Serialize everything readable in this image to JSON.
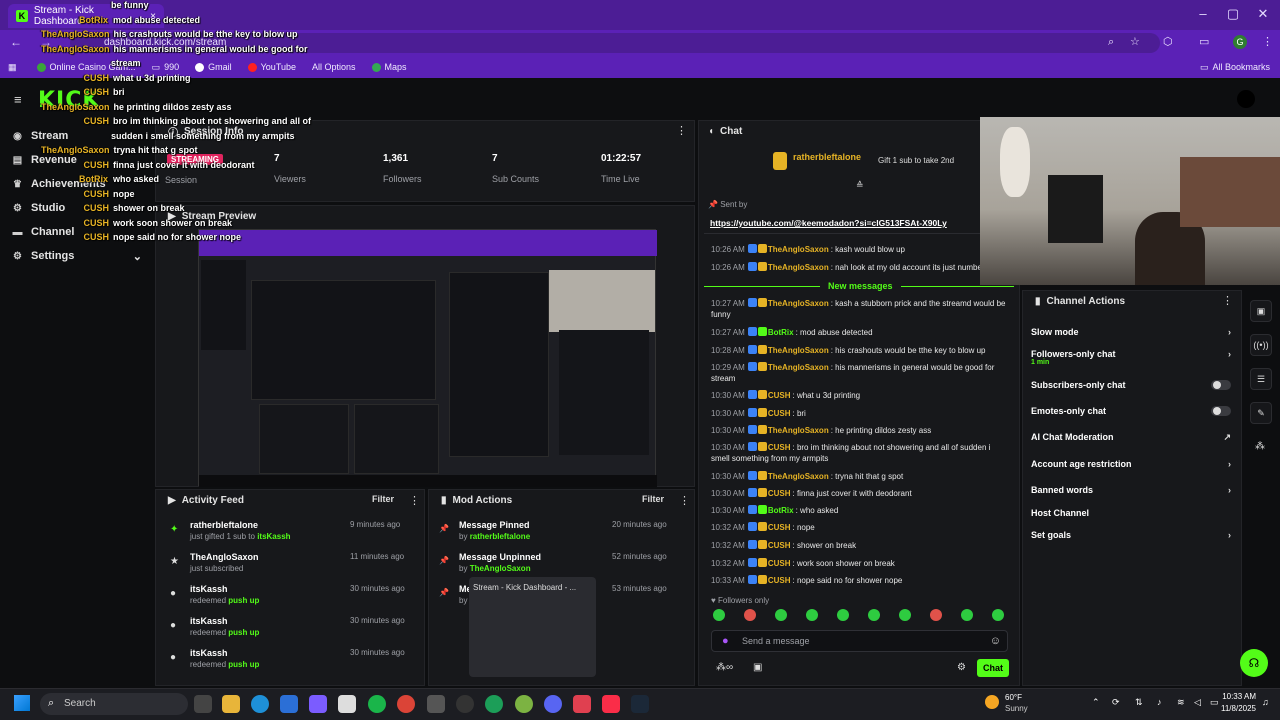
{
  "browser": {
    "tab_title": "Stream - Kick Dashboard",
    "url": "dashboard.kick.com/stream",
    "bookmarks": [
      "Online Casino Gam...",
      "990",
      "Gmail",
      "YouTube",
      "All Options",
      "Maps"
    ],
    "all_bookmarks": "All Bookmarks",
    "profile_letter": "G"
  },
  "app": {
    "logo": "KICK",
    "nav": [
      "Stream",
      "Revenue",
      "Achievements",
      "Studio",
      "Channel",
      "Settings"
    ],
    "session_info_title": "Session Info",
    "session": {
      "badge": "STREAMING",
      "label": "Session"
    },
    "stats": [
      {
        "value": "7",
        "label": "Viewers"
      },
      {
        "value": "1,361",
        "label": "Followers"
      },
      {
        "value": "7",
        "label": "Sub Counts"
      },
      {
        "value": "01:22:57",
        "label": "Time Live"
      }
    ],
    "stream_preview_title": "Stream Preview",
    "activity_feed": {
      "title": "Activity Feed",
      "filter": "Filter",
      "items": [
        {
          "name": "ratherbleftalone",
          "sub": "just gifted",
          "sub2": "1 sub to",
          "target": "itsKassh",
          "time": "9 minutes ago"
        },
        {
          "name": "TheAngloSaxon",
          "sub": "just subscribed",
          "sub2": "",
          "target": "",
          "time": "11 minutes ago"
        },
        {
          "name": "itsKassh",
          "sub": "redeemed",
          "sub2": "",
          "target": "push up",
          "time": "30 minutes ago"
        },
        {
          "name": "itsKassh",
          "sub": "redeemed",
          "sub2": "",
          "target": "push up",
          "time": "30 minutes ago"
        },
        {
          "name": "itsKassh",
          "sub": "redeemed",
          "sub2": "",
          "target": "push up",
          "time": "30 minutes ago"
        }
      ]
    },
    "mod_actions": {
      "title": "Mod Actions",
      "filter": "Filter",
      "items": [
        {
          "name": "Message Pinned",
          "by": "by",
          "who": "ratherbleftalone",
          "time": "20 minutes ago"
        },
        {
          "name": "Message Unpinned",
          "by": "by",
          "who": "TheAngloSaxon",
          "time": "52 minutes ago"
        },
        {
          "name": "Me",
          "by": "by",
          "who": "",
          "time": "53 minutes ago"
        }
      ],
      "tooltip": "Stream - Kick Dashboard - ..."
    }
  },
  "chat": {
    "title": "Chat",
    "pinned_user": "ratherbleftalone",
    "pinned_text": "Gift 1 sub to take 2nd",
    "sent_by": "Sent by",
    "pinned_link": "https://youtube.com/@keemodadon?si=cIG513FSAt-X90Ly",
    "new_messages": "New messages",
    "messages": [
      {
        "time": "10:26 AM",
        "user": "TheAngloSaxon",
        "text": "kash would blow up",
        "color": "gold"
      },
      {
        "time": "10:26 AM",
        "user": "TheAngloSaxon",
        "text": "nah look at my old account its just numbe",
        "color": "gold"
      },
      {
        "time": "10:27 AM",
        "user": "TheAngloSaxon",
        "text": "kash a stubborn prick and the streamd would be funny",
        "color": "gold"
      },
      {
        "time": "10:27 AM",
        "user": "BotRix",
        "text": "mod abuse detected",
        "color": "grn"
      },
      {
        "time": "10:28 AM",
        "user": "TheAngloSaxon",
        "text": "his crashouts would be tthe key to blow up",
        "color": "gold"
      },
      {
        "time": "10:29 AM",
        "user": "TheAngloSaxon",
        "text": "his mannerisms in general would be good for stream",
        "color": "gold"
      },
      {
        "time": "10:30 AM",
        "user": "CUSH",
        "text": "what u 3d printing",
        "color": "gold"
      },
      {
        "time": "10:30 AM",
        "user": "CUSH",
        "text": "bri",
        "color": "gold"
      },
      {
        "time": "10:30 AM",
        "user": "TheAngloSaxon",
        "text": "he printing dildos zesty ass",
        "color": "gold"
      },
      {
        "time": "10:30 AM",
        "user": "CUSH",
        "text": "bro im thinking about not showering and all of sudden i smell something from my armpits",
        "color": "gold"
      },
      {
        "time": "10:30 AM",
        "user": "TheAngloSaxon",
        "text": "tryna hit that g spot",
        "color": "gold"
      },
      {
        "time": "10:30 AM",
        "user": "CUSH",
        "text": "finna just cover it with deodorant",
        "color": "gold"
      },
      {
        "time": "10:30 AM",
        "user": "BotRix",
        "text": "who asked",
        "color": "grn"
      },
      {
        "time": "10:32 AM",
        "user": "CUSH",
        "text": "nope",
        "color": "gold"
      },
      {
        "time": "10:32 AM",
        "user": "CUSH",
        "text": "shower on break",
        "color": "gold"
      },
      {
        "time": "10:32 AM",
        "user": "CUSH",
        "text": "work soon shower on break",
        "color": "gold"
      },
      {
        "time": "10:33 AM",
        "user": "CUSH",
        "text": "nope said no for shower nope",
        "color": "gold"
      }
    ],
    "followers_only": "Followers only",
    "input_placeholder": "Send a message",
    "send_label": "Chat"
  },
  "channel_actions": {
    "title": "Channel Actions",
    "items": [
      {
        "label": "Slow mode",
        "kind": "chevron"
      },
      {
        "label": "Followers-only chat",
        "sub": "1 min",
        "kind": "chevron"
      },
      {
        "label": "Subscribers-only chat",
        "kind": "toggle"
      },
      {
        "label": "Emotes-only chat",
        "kind": "toggle"
      },
      {
        "label": "AI Chat Moderation",
        "kind": "external"
      },
      {
        "label": "Account age restriction",
        "kind": "chevron"
      },
      {
        "label": "Banned words",
        "kind": "chevron"
      },
      {
        "label": "Host Channel",
        "kind": "none"
      },
      {
        "label": "Set goals",
        "kind": "chevron"
      }
    ]
  },
  "overlay_chat": [
    {
      "user": "",
      "text": "be funny"
    },
    {
      "user": "BotRix",
      "text": "mod abuse detected"
    },
    {
      "user": "TheAngloSaxon",
      "text": "his crashouts would be tthe key to blow up"
    },
    {
      "user": "TheAngloSaxon",
      "text": "his mannerisms in general would be good for"
    },
    {
      "user": "",
      "text": "stream"
    },
    {
      "user": "CUSH",
      "text": "what u 3d printing"
    },
    {
      "user": "CUSH",
      "text": "bri"
    },
    {
      "user": "TheAngloSaxon",
      "text": "he printing dildos zesty ass"
    },
    {
      "user": "CUSH",
      "text": "bro im thinking about not showering and all of"
    },
    {
      "user": "",
      "text": "sudden i smell something from my armpits"
    },
    {
      "user": "TheAngloSaxon",
      "text": "tryna hit that g spot"
    },
    {
      "user": "CUSH",
      "text": "finna just cover it with deodorant"
    },
    {
      "user": "BotRix",
      "text": "who asked"
    },
    {
      "user": "CUSH",
      "text": "nope"
    },
    {
      "user": "CUSH",
      "text": "shower on break"
    },
    {
      "user": "CUSH",
      "text": "work soon shower on break"
    },
    {
      "user": "CUSH",
      "text": "nope said no for shower nope"
    }
  ],
  "taskbar": {
    "search": "Search",
    "weather_temp": "60°F",
    "weather_text": "Sunny",
    "time": "10:33 AM",
    "date": "11/8/2025"
  },
  "colors": {
    "brand": "#53fc18",
    "chrome": "#5b21b6",
    "panel": "#17181b"
  }
}
